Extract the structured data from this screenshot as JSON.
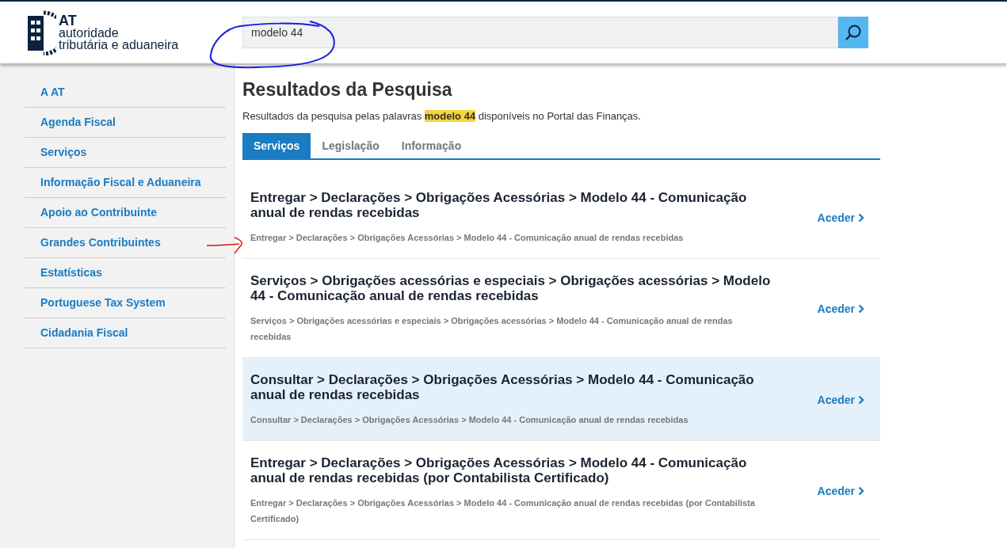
{
  "header": {
    "logo": {
      "abbr": "AT",
      "line1": "autoridade",
      "line2": "tributária e aduaneira"
    },
    "search": {
      "value": "modelo 44"
    }
  },
  "sidebar": {
    "items": [
      {
        "label": "A AT"
      },
      {
        "label": "Agenda Fiscal"
      },
      {
        "label": "Serviços"
      },
      {
        "label": "Informação Fiscal e Aduaneira"
      },
      {
        "label": "Apoio ao Contribuinte"
      },
      {
        "label": "Grandes Contribuintes"
      },
      {
        "label": "Estatísticas"
      },
      {
        "label": "Portuguese Tax System"
      },
      {
        "label": "Cidadania Fiscal"
      }
    ]
  },
  "main": {
    "title": "Resultados da Pesquisa",
    "intro": "Resultados da pesquisa pelas palavras **modelo 44** disponíveis no Portal das Finanças.",
    "tabs": [
      {
        "label": "Serviços",
        "selected": true
      },
      {
        "label": "Legislação",
        "selected": false
      },
      {
        "label": "Informação",
        "selected": false
      }
    ],
    "results": [
      {
        "title": "Entregar > Declarações > Obrigações Acessórias > Modelo 44 - Comunicação anual de rendas recebidas",
        "path": "Entregar > Declarações > Obrigações Acessórias > Modelo 44 - Comunicação anual de rendas recebidas",
        "link": "Aceder",
        "highlighted": false
      },
      {
        "title": "Serviços > Obrigações acessórias e especiais > Obrigações acessórias > Modelo 44 - Comunicação anual de rendas recebidas",
        "path": "Serviços > Obrigações acessórias e especiais > Obrigações acessórias > Modelo 44 - Comunicação anual de rendas recebidas",
        "link": "Aceder",
        "highlighted": false
      },
      {
        "title": "Consultar > Declarações > Obrigações Acessórias > Modelo 44 - Comunicação anual de rendas recebidas",
        "path": "Consultar > Declarações > Obrigações Acessórias > Modelo 44 - Comunicação anual de rendas recebidas",
        "link": "Aceder",
        "highlighted": true
      },
      {
        "title": "Entregar > Declarações > Obrigações Acessórias > Modelo 44 - Comunicação anual de rendas recebidas (por Contabilista Certificado)",
        "path": "Entregar > Declarações > Obrigações Acessórias > Modelo 44 - Comunicação anual de rendas recebidas (por Contabilista Certificado)",
        "link": "Aceder",
        "highlighted": false
      }
    ]
  }
}
